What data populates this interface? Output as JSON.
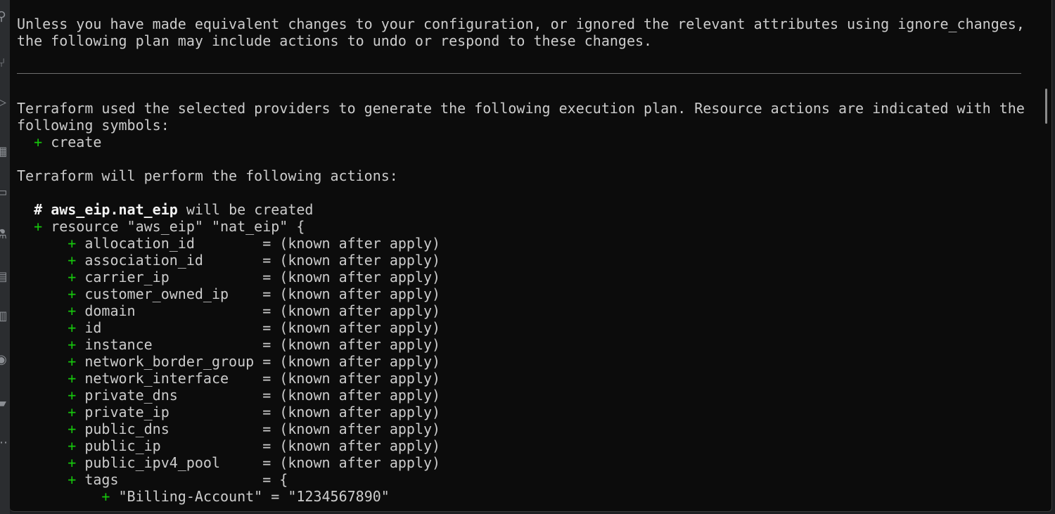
{
  "activity_bar": {
    "icons": [
      "search-icon",
      "source-control-icon",
      "run-debug-icon",
      "extensions-icon",
      "terminal-icon",
      "testing-icon",
      "notebook-icon",
      "database-icon",
      "github-icon",
      "docker-icon",
      "more-icon"
    ]
  },
  "terminal": {
    "warning_line1": "Unless you have made equivalent changes to your configuration, or ignored the relevant attributes using ignore_changes,",
    "warning_line2": "the following plan may include actions to undo or respond to these changes.",
    "plan_intro_line1": "Terraform used the selected providers to generate the following execution plan. Resource actions are indicated with the",
    "plan_intro_line2": "following symbols:",
    "symbol_plus": "+",
    "symbol_create": "create",
    "actions_heading": "Terraform will perform the following actions:",
    "resource_comment_hash": "#",
    "resource_address": "aws_eip.nat_eip",
    "resource_comment_suffix": "will be created",
    "resource_decl": "resource \"aws_eip\" \"nat_eip\" {",
    "attributes": [
      {
        "name": "allocation_id",
        "value": "= (known after apply)"
      },
      {
        "name": "association_id",
        "value": "= (known after apply)"
      },
      {
        "name": "carrier_ip",
        "value": "= (known after apply)"
      },
      {
        "name": "customer_owned_ip",
        "value": "= (known after apply)"
      },
      {
        "name": "domain",
        "value": "= (known after apply)"
      },
      {
        "name": "id",
        "value": "= (known after apply)"
      },
      {
        "name": "instance",
        "value": "= (known after apply)"
      },
      {
        "name": "network_border_group",
        "value": "= (known after apply)"
      },
      {
        "name": "network_interface",
        "value": "= (known after apply)"
      },
      {
        "name": "private_dns",
        "value": "= (known after apply)"
      },
      {
        "name": "private_ip",
        "value": "= (known after apply)"
      },
      {
        "name": "public_dns",
        "value": "= (known after apply)"
      },
      {
        "name": "public_ip",
        "value": "= (known after apply)"
      },
      {
        "name": "public_ipv4_pool",
        "value": "= (known after apply)"
      },
      {
        "name": "tags",
        "value": "= {"
      }
    ],
    "tag_entry": "\"Billing-Account\" = \"1234567890\""
  },
  "colors": {
    "terminal_bg": "#0c0c0c",
    "text": "#cccccc",
    "plus_green": "#16c60c",
    "bold_white": "#f2f2f2"
  }
}
